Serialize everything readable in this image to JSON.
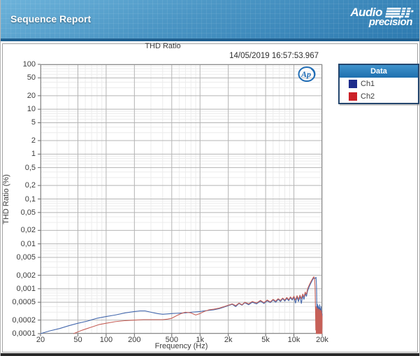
{
  "header": {
    "title": "Sequence Report",
    "brand_line1": "Audio",
    "brand_line2": "precision"
  },
  "chart": {
    "title": "THD Ratio",
    "timestamp": "14/05/2019 16:57:53.967",
    "xlabel": "Frequency (Hz)",
    "ylabel": "THD Ratio (%)",
    "ap_mark": "Ap",
    "x_ticks": [
      {
        "v": 20,
        "t": "20"
      },
      {
        "v": 50,
        "t": "50"
      },
      {
        "v": 100,
        "t": "100"
      },
      {
        "v": 200,
        "t": "200"
      },
      {
        "v": 500,
        "t": "500"
      },
      {
        "v": 1000,
        "t": "1k"
      },
      {
        "v": 2000,
        "t": "2k"
      },
      {
        "v": 5000,
        "t": "5k"
      },
      {
        "v": 10000,
        "t": "10k"
      },
      {
        "v": 20000,
        "t": "20k"
      }
    ],
    "y_ticks": [
      {
        "v": 100,
        "t": "100"
      },
      {
        "v": 50,
        "t": "50"
      },
      {
        "v": 20,
        "t": "20"
      },
      {
        "v": 10,
        "t": "10"
      },
      {
        "v": 5,
        "t": "5"
      },
      {
        "v": 2,
        "t": "2"
      },
      {
        "v": 1,
        "t": "1"
      },
      {
        "v": 0.5,
        "t": "0,5"
      },
      {
        "v": 0.2,
        "t": "0,2"
      },
      {
        "v": 0.1,
        "t": "0,1"
      },
      {
        "v": 0.05,
        "t": "0,05"
      },
      {
        "v": 0.02,
        "t": "0,02"
      },
      {
        "v": 0.01,
        "t": "0,01"
      },
      {
        "v": 0.005,
        "t": "0,005"
      },
      {
        "v": 0.002,
        "t": "0,002"
      },
      {
        "v": 0.001,
        "t": "0,001"
      },
      {
        "v": 0.0005,
        "t": "0,0005"
      },
      {
        "v": 0.0002,
        "t": "0,0002"
      },
      {
        "v": 0.0001,
        "t": "0,0001"
      }
    ]
  },
  "legend": {
    "title": "Data",
    "items": [
      {
        "label": "Ch1",
        "color": "#1e2d8c"
      },
      {
        "label": "Ch2",
        "color": "#cb2027"
      }
    ]
  },
  "colors": {
    "grid_major": "#b4b4b4",
    "grid_minor": "#ececec",
    "plot_border": "#8c8c8c",
    "tick": "#666666"
  },
  "chart_data": {
    "type": "line",
    "title": "THD Ratio",
    "xlabel": "Frequency (Hz)",
    "ylabel": "THD Ratio (%)",
    "x_scale": "log",
    "y_scale": "log",
    "xlim": [
      20,
      20000
    ],
    "ylim": [
      0.0001,
      100
    ],
    "grid": true,
    "legend_position": "outside-top-right",
    "series": [
      {
        "name": "Ch1",
        "color": "#4468ad",
        "points": [
          [
            20,
            0.0001
          ],
          [
            25,
            0.000115
          ],
          [
            32,
            0.00013
          ],
          [
            40,
            0.00015
          ],
          [
            50,
            0.00017
          ],
          [
            63,
            0.00019
          ],
          [
            80,
            0.00022
          ],
          [
            100,
            0.00024
          ],
          [
            125,
            0.00026
          ],
          [
            160,
            0.00029
          ],
          [
            200,
            0.00031
          ],
          [
            230,
            0.00032
          ],
          [
            260,
            0.00032
          ],
          [
            300,
            0.0003
          ],
          [
            350,
            0.00028
          ],
          [
            400,
            0.00027
          ],
          [
            450,
            0.000275
          ],
          [
            500,
            0.00028
          ],
          [
            600,
            0.000285
          ],
          [
            700,
            0.00029
          ],
          [
            800,
            0.0003
          ],
          [
            900,
            0.000305
          ],
          [
            1000,
            0.00031
          ],
          [
            1100,
            0.00032
          ],
          [
            1250,
            0.00033
          ],
          [
            1400,
            0.00034
          ],
          [
            1600,
            0.00036
          ],
          [
            1800,
            0.00039
          ],
          [
            2000,
            0.00042
          ],
          [
            2200,
            0.00045
          ],
          [
            2400,
            0.0004
          ],
          [
            2600,
            0.00047
          ],
          [
            2800,
            0.00043
          ],
          [
            3000,
            0.00049
          ],
          [
            3300,
            0.00044
          ],
          [
            3600,
            0.0005
          ],
          [
            4000,
            0.00046
          ],
          [
            4400,
            0.00053
          ],
          [
            4800,
            0.00047
          ],
          [
            5200,
            0.00054
          ],
          [
            5600,
            0.00049
          ],
          [
            6000,
            0.00056
          ],
          [
            6400,
            0.0005
          ],
          [
            6800,
            0.00058
          ],
          [
            7200,
            0.00052
          ],
          [
            7600,
            0.0006
          ],
          [
            8000,
            0.00053
          ],
          [
            8400,
            0.00061
          ],
          [
            8800,
            0.00054
          ],
          [
            9200,
            0.00063
          ],
          [
            9600,
            0.00056
          ],
          [
            10000,
            0.00064
          ],
          [
            10400,
            0.00048
          ],
          [
            10800,
            0.00066
          ],
          [
            11200,
            0.00052
          ],
          [
            11600,
            0.00068
          ],
          [
            12000,
            0.00047
          ],
          [
            12400,
            0.0007
          ],
          [
            12800,
            0.00058
          ],
          [
            13200,
            0.00078
          ],
          [
            13600,
            0.00068
          ],
          [
            14000,
            0.0009
          ],
          [
            14400,
            0.00105
          ],
          [
            14800,
            0.0012
          ],
          [
            15200,
            0.00135
          ],
          [
            15600,
            0.0015
          ],
          [
            16000,
            0.00165
          ],
          [
            16400,
            0.00175
          ],
          [
            16800,
            0.0017
          ],
          [
            17200,
            0.0018
          ],
          [
            17400,
            0.0012
          ],
          [
            17500,
            0.0006
          ],
          [
            17600,
            0.00025
          ],
          [
            17700,
            0.00012
          ],
          [
            17800,
            0.00045
          ],
          [
            17900,
            0.00012
          ],
          [
            18000,
            0.0004
          ],
          [
            18100,
            0.00013
          ],
          [
            18250,
            0.00042
          ],
          [
            18400,
            0.00012
          ],
          [
            18550,
            0.00038
          ],
          [
            18700,
            0.00013
          ],
          [
            18850,
            0.00044
          ],
          [
            19000,
            0.00012
          ],
          [
            19150,
            0.00036
          ],
          [
            19300,
            0.00013
          ],
          [
            19450,
            0.0004
          ],
          [
            19600,
            0.00012
          ],
          [
            19750,
            0.00032
          ],
          [
            19900,
            0.00013
          ],
          [
            20000,
            0.00028
          ]
        ]
      },
      {
        "name": "Ch2",
        "color": "#c66058",
        "points": [
          [
            45,
            0.0001
          ],
          [
            56,
            0.00012
          ],
          [
            70,
            0.00014
          ],
          [
            85,
            0.00016
          ],
          [
            100,
            0.00017
          ],
          [
            125,
            0.000185
          ],
          [
            160,
            0.000195
          ],
          [
            200,
            0.0002
          ],
          [
            250,
            0.000205
          ],
          [
            300,
            0.000205
          ],
          [
            350,
            0.000205
          ],
          [
            400,
            0.000205
          ],
          [
            450,
            0.00021
          ],
          [
            500,
            0.00022
          ],
          [
            560,
            0.00025
          ],
          [
            630,
            0.00028
          ],
          [
            700,
            0.0003
          ],
          [
            800,
            0.00029
          ],
          [
            900,
            0.00026
          ],
          [
            1000,
            0.00028
          ],
          [
            1100,
            0.00031
          ],
          [
            1250,
            0.00034
          ],
          [
            1400,
            0.00035
          ],
          [
            1600,
            0.00037
          ],
          [
            1800,
            0.0004
          ],
          [
            2000,
            0.00043
          ],
          [
            2200,
            0.00046
          ],
          [
            2400,
            0.00042
          ],
          [
            2600,
            0.00048
          ],
          [
            2800,
            0.00044
          ],
          [
            3000,
            0.0005
          ],
          [
            3300,
            0.00046
          ],
          [
            3600,
            0.00052
          ],
          [
            4000,
            0.00048
          ],
          [
            4400,
            0.00055
          ],
          [
            4800,
            0.00049
          ],
          [
            5200,
            0.00056
          ],
          [
            5600,
            0.00051
          ],
          [
            6000,
            0.00058
          ],
          [
            6400,
            0.00053
          ],
          [
            6800,
            0.0006
          ],
          [
            7200,
            0.00055
          ],
          [
            7600,
            0.00062
          ],
          [
            8000,
            0.00056
          ],
          [
            8400,
            0.00064
          ],
          [
            8800,
            0.00057
          ],
          [
            9200,
            0.00066
          ],
          [
            9600,
            0.00059
          ],
          [
            10000,
            0.00068
          ],
          [
            10400,
            0.00056
          ],
          [
            10800,
            0.0007
          ],
          [
            11200,
            0.00058
          ],
          [
            11600,
            0.00072
          ],
          [
            12000,
            0.0006
          ],
          [
            12400,
            0.00076
          ],
          [
            12800,
            0.00066
          ],
          [
            13200,
            0.00084
          ],
          [
            13600,
            0.00075
          ],
          [
            14000,
            0.001
          ],
          [
            14400,
            0.00115
          ],
          [
            14800,
            0.0013
          ],
          [
            15200,
            0.00145
          ],
          [
            15600,
            0.0016
          ],
          [
            16000,
            0.00175
          ],
          [
            16300,
            0.00185
          ],
          [
            16600,
            0.00165
          ],
          [
            16800,
            0.0011
          ],
          [
            16900,
            0.0006
          ],
          [
            17000,
            0.0003
          ],
          [
            17100,
            0.00012
          ],
          [
            17200,
            0.0004
          ],
          [
            17300,
            0.0001
          ],
          [
            17400,
            0.00035
          ],
          [
            17500,
            0.0001
          ],
          [
            17600,
            0.00038
          ],
          [
            17700,
            0.0001
          ],
          [
            17800,
            0.00033
          ],
          [
            17900,
            0.0001
          ],
          [
            18000,
            0.00036
          ],
          [
            18100,
            0.0001
          ],
          [
            18200,
            0.00032
          ],
          [
            18300,
            0.0001
          ],
          [
            18400,
            0.00035
          ],
          [
            18500,
            0.0001
          ],
          [
            18600,
            0.0003
          ],
          [
            18700,
            0.0001
          ],
          [
            18800,
            0.00034
          ],
          [
            18900,
            0.0001
          ],
          [
            19000,
            0.00031
          ],
          [
            19100,
            0.0001
          ],
          [
            19200,
            0.00033
          ],
          [
            19300,
            0.0001
          ],
          [
            19400,
            0.00029
          ],
          [
            19500,
            0.0001
          ],
          [
            19600,
            0.00032
          ],
          [
            19700,
            0.0001
          ],
          [
            19800,
            0.00028
          ],
          [
            19900,
            0.0001
          ],
          [
            20000,
            0.00025
          ]
        ]
      }
    ]
  }
}
